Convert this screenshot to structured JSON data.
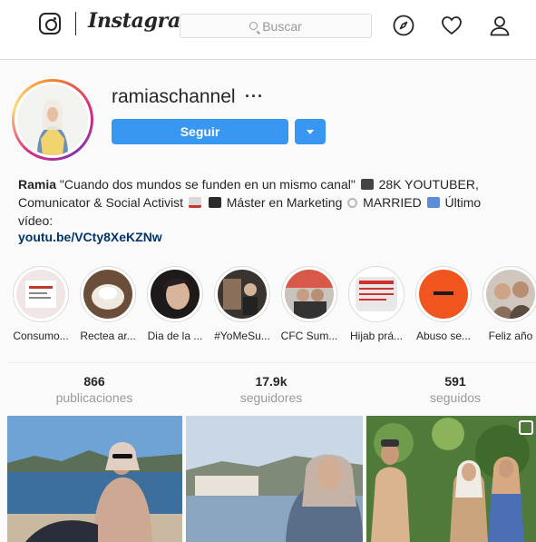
{
  "nav": {
    "wordmark": "Instagram",
    "search_placeholder": "Buscar"
  },
  "profile": {
    "username": "ramiaschannel",
    "more": "···",
    "follow_label": "Seguir",
    "ring_colors": [
      "#f58529",
      "#dd2a7b",
      "#8134af",
      "#feda77"
    ],
    "button_color": "#3897f0"
  },
  "bio": {
    "name": "Ramia",
    "line1": "\"Cuando dos mundos se funden en un mismo canal\"",
    "line1b": "28K YOUTUBER,",
    "line2a": "Comunicator & Social Activist",
    "line2b": "Máster en Marketing",
    "line2c": "MARRIED",
    "line2d": "Último",
    "line3": "vídeo:",
    "link": "youtu.be/VCty8XeKZNw"
  },
  "highlights": [
    {
      "label": "Consumo..."
    },
    {
      "label": "Rectea ar..."
    },
    {
      "label": "Dia de la ..."
    },
    {
      "label": "#YoMeSu..."
    },
    {
      "label": "CFC Sum..."
    },
    {
      "label": "Hijab prá..."
    },
    {
      "label": "Abuso se..."
    },
    {
      "label": "Feliz año"
    }
  ],
  "stats": [
    {
      "value": "866",
      "label": "publicaciones"
    },
    {
      "value": "17.9k",
      "label": "seguidores"
    },
    {
      "value": "591",
      "label": "seguidos"
    }
  ]
}
